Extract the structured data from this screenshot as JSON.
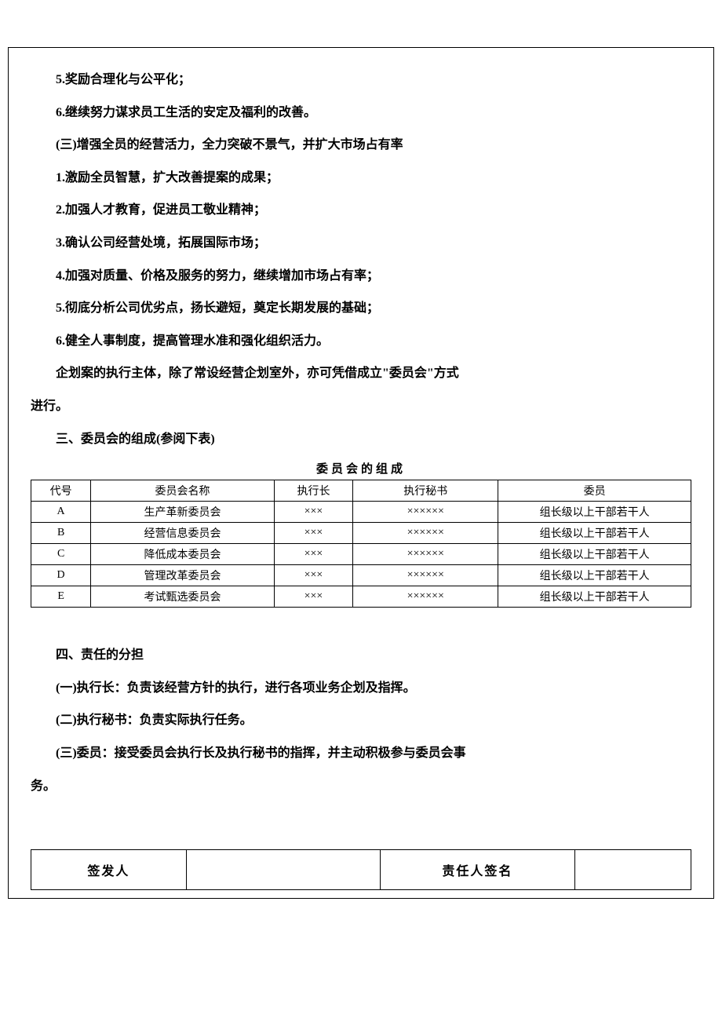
{
  "paragraphs": {
    "p1": "5.奖励合理化与公平化；",
    "p2": "6.继续努力谋求员工生活的安定及福利的改善。",
    "p3": "(三)增强全员的经营活力，全力突破不景气，并扩大市场占有率",
    "p4": "1.激励全员智慧，扩大改善提案的成果；",
    "p5": "2.加强人才教育，促进员工敬业精神；",
    "p6": "3.确认公司经营处境，拓展国际市场；",
    "p7": "4.加强对质量、价格及服务的努力，继续增加市场占有率；",
    "p8": "5.彻底分析公司优劣点，扬长避短，奠定长期发展的基础；",
    "p9": "6.健全人事制度，提高管理水准和强化组织活力。",
    "p10a": "企划案的执行主体，除了常设经营企划室外，亦可凭借成立\"委员会\"方式",
    "p10b": "进行。",
    "h3": "三、委员会的组成(参阅下表)",
    "caption": "委员会的组成",
    "h4": "四、责任的分担",
    "r1": "(一)执行长：负责该经营方针的执行，进行各项业务企划及指挥。",
    "r2": "(二)执行秘书：负责实际执行任务。",
    "r3a": "(三)委员：接受委员会执行长及执行秘书的指挥，并主动积极参与委员会事",
    "r3b": "务。",
    "sign1": "签发人",
    "sign2": "责任人签名"
  },
  "table_headers": {
    "code": "代号",
    "name": "委员会名称",
    "chief": "执行长",
    "secretary": "执行秘书",
    "member": "委员"
  },
  "table_rows": [
    {
      "code": "A",
      "name": "生产革新委员会",
      "chief": "×××",
      "secretary": "××××××",
      "member": "组长级以上干部若干人"
    },
    {
      "code": "B",
      "name": "经营信息委员会",
      "chief": "×××",
      "secretary": "××××××",
      "member": "组长级以上干部若干人"
    },
    {
      "code": "C",
      "name": "降低成本委员会",
      "chief": "×××",
      "secretary": "××××××",
      "member": "组长级以上干部若干人"
    },
    {
      "code": "D",
      "name": "管理改革委员会",
      "chief": "×××",
      "secretary": "××××××",
      "member": "组长级以上干部若干人"
    },
    {
      "code": "E",
      "name": "考试甄选委员会",
      "chief": "×××",
      "secretary": "××××××",
      "member": "组长级以上干部若干人"
    }
  ]
}
